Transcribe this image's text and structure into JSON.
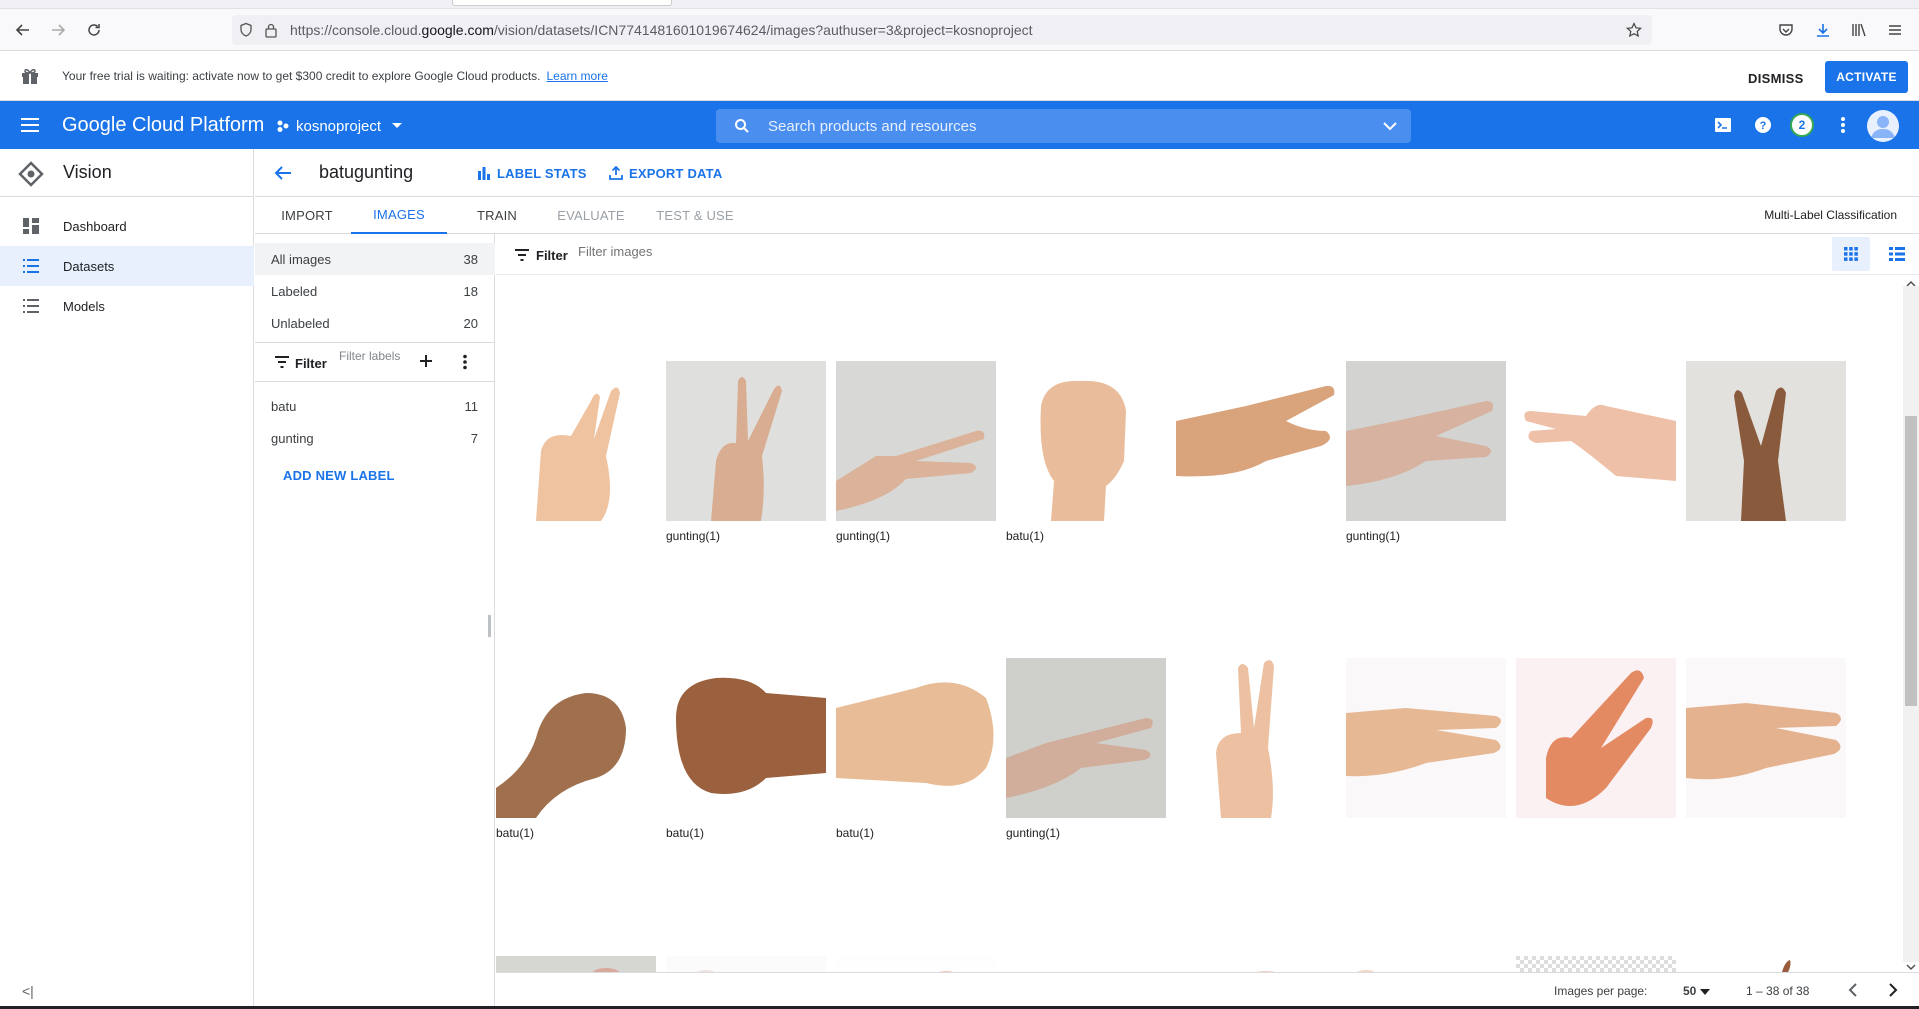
{
  "browser": {
    "url_prefix": "https://console.cloud.",
    "url_host": "google.com",
    "url_rest": "/vision/datasets/ICN7741481601019674624/images?authuser=3&project=kosnoproject"
  },
  "trial_banner": {
    "message": "Your free trial is waiting: activate now to get $300 credit to explore Google Cloud products.",
    "learn_more": "Learn more",
    "dismiss": "DISMISS",
    "activate": "ACTIVATE"
  },
  "header": {
    "brand": "Google Cloud Platform",
    "project": "kosnoproject",
    "search_placeholder": "Search products and resources",
    "notification_count": "2"
  },
  "sidebar": {
    "product": "Vision",
    "items": [
      {
        "label": "Dashboard"
      },
      {
        "label": "Datasets"
      },
      {
        "label": "Models"
      }
    ],
    "collapse": "<|"
  },
  "dataset": {
    "name": "batugunting",
    "label_stats": "LABEL STATS",
    "export_data": "EXPORT DATA"
  },
  "tabs": [
    {
      "label": "IMPORT"
    },
    {
      "label": "IMAGES"
    },
    {
      "label": "TRAIN"
    },
    {
      "label": "EVALUATE"
    },
    {
      "label": "TEST & USE"
    }
  ],
  "classification_type": "Multi-Label Classification",
  "image_categories": [
    {
      "label": "All images",
      "count": "38"
    },
    {
      "label": "Labeled",
      "count": "18"
    },
    {
      "label": "Unlabeled",
      "count": "20"
    }
  ],
  "label_filter": {
    "filter": "Filter",
    "placeholder": "Filter labels"
  },
  "labels": [
    {
      "name": "batu",
      "count": "11"
    },
    {
      "name": "gunting",
      "count": "7"
    }
  ],
  "add_new_label": "ADD NEW LABEL",
  "grid": {
    "filter": "Filter",
    "placeholder": "Filter images",
    "rows": [
      [
        "",
        "gunting(1)",
        "gunting(1)",
        "batu(1)",
        "",
        "gunting(1)",
        "",
        ""
      ],
      [
        "batu(1)",
        "batu(1)",
        "batu(1)",
        "gunting(1)",
        "",
        "",
        "",
        ""
      ]
    ]
  },
  "pagination": {
    "images_per_page_label": "Images per page:",
    "images_per_page": "50",
    "range": "1 – 38 of 38"
  },
  "colors": {
    "primary": "#1a73e8",
    "header_bg": "#1a73e8",
    "selected_bg": "#e8f0fe"
  }
}
